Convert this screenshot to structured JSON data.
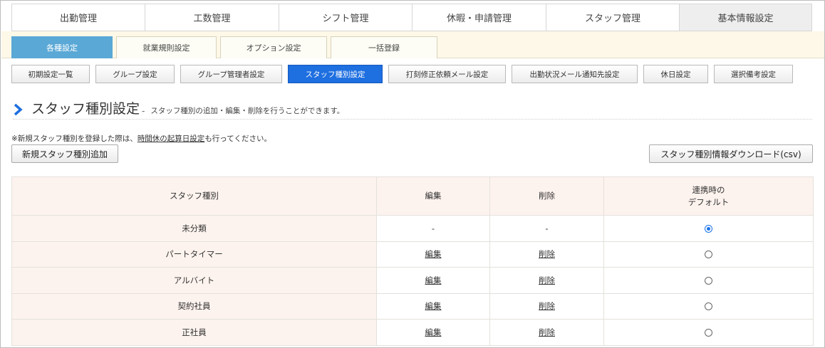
{
  "topnav": {
    "tabs": [
      {
        "label": "出勤管理",
        "active": false
      },
      {
        "label": "工数管理",
        "active": false
      },
      {
        "label": "シフト管理",
        "active": false
      },
      {
        "label": "休暇・申請管理",
        "active": false
      },
      {
        "label": "スタッフ管理",
        "active": false
      },
      {
        "label": "基本情報設定",
        "active": true
      }
    ]
  },
  "subtabs": [
    {
      "label": "各種設定",
      "active": true
    },
    {
      "label": "就業規則設定",
      "active": false
    },
    {
      "label": "オプション設定",
      "active": false
    },
    {
      "label": "一括登録",
      "active": false
    }
  ],
  "settings_buttons": [
    {
      "label": "初期設定一覧",
      "active": false
    },
    {
      "label": "グループ設定",
      "active": false
    },
    {
      "label": "グループ管理者設定",
      "active": false
    },
    {
      "label": "スタッフ種別設定",
      "active": true
    },
    {
      "label": "打刻修正依頼メール設定",
      "active": false
    },
    {
      "label": "出勤状況メール通知先設定",
      "active": false
    },
    {
      "label": "休日設定",
      "active": false
    },
    {
      "label": "選択備考設定",
      "active": false
    }
  ],
  "page": {
    "title": "スタッフ種別設定",
    "dash": "-",
    "description": "スタッフ種別の追加・編集・削除を行うことができます。",
    "note_prefix": "※新規スタッフ種別を登録した際は、",
    "note_link": "時間休の起算日設定",
    "note_suffix": "も行ってください。",
    "add_button": "新規スタッフ種別追加",
    "download_button": "スタッフ種別情報ダウンロード(csv)"
  },
  "table": {
    "headers": {
      "name": "スタッフ種別",
      "edit": "編集",
      "delete": "削除",
      "default_line1": "連携時の",
      "default_line2": "デフォルト"
    },
    "rows": [
      {
        "name": "未分類",
        "edit": "-",
        "delete": "-",
        "edit_link": false,
        "default_checked": true
      },
      {
        "name": "パートタイマー",
        "edit": "編集",
        "delete": "削除",
        "edit_link": true,
        "default_checked": false
      },
      {
        "name": "アルバイト",
        "edit": "編集",
        "delete": "削除",
        "edit_link": true,
        "default_checked": false
      },
      {
        "name": "契約社員",
        "edit": "編集",
        "delete": "削除",
        "edit_link": true,
        "default_checked": false
      },
      {
        "name": "正社員",
        "edit": "編集",
        "delete": "削除",
        "edit_link": true,
        "default_checked": false
      }
    ]
  },
  "colors": {
    "accent_blue": "#1e6fe0",
    "subtab_active": "#5aa8d6",
    "band_bg": "#fdf8e7",
    "table_header_bg": "#fdf3ee"
  }
}
